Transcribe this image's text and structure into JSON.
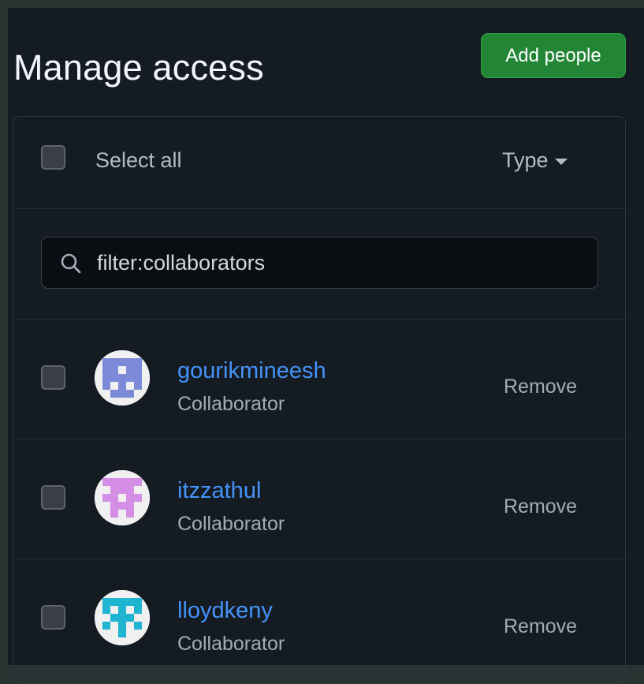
{
  "header": {
    "title": "Manage access",
    "add_button_label": "Add people"
  },
  "list_header": {
    "select_all_label": "Select all",
    "type_label": "Type"
  },
  "search": {
    "value": "filter:collaborators",
    "icon": "search-icon"
  },
  "members": [
    {
      "username": "gourikmineesh",
      "role": "Collaborator",
      "remove_label": "Remove",
      "avatar_color": "#7d8ad8"
    },
    {
      "username": "itzzathul",
      "role": "Collaborator",
      "remove_label": "Remove",
      "avatar_color": "#d58ee6"
    },
    {
      "username": "lloydkeny",
      "role": "Collaborator",
      "remove_label": "Remove",
      "avatar_color": "#1fb4d1"
    }
  ],
  "colors": {
    "background": "#151b23",
    "accent_green": "#238636",
    "link_blue": "#4493f8"
  }
}
